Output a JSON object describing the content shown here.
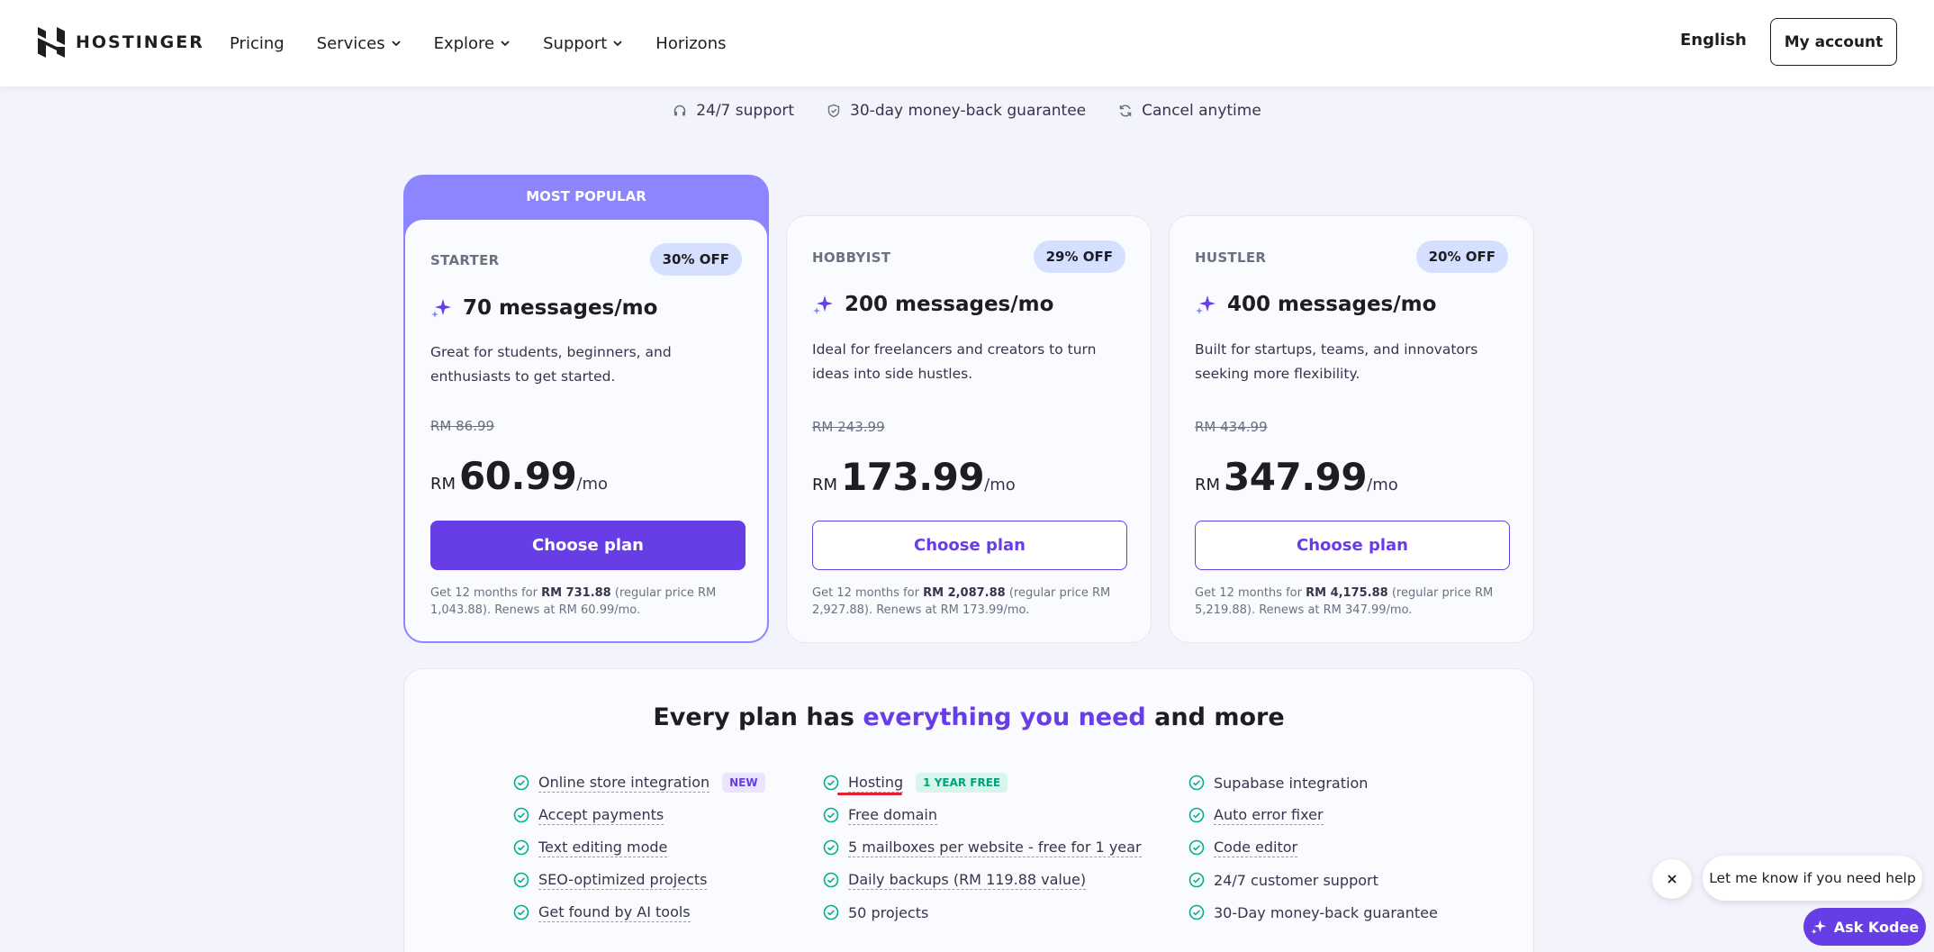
{
  "header": {
    "brand": "HOSTINGER",
    "nav": [
      {
        "label": "Pricing",
        "dropdown": false
      },
      {
        "label": "Services",
        "dropdown": true
      },
      {
        "label": "Explore",
        "dropdown": true
      },
      {
        "label": "Support",
        "dropdown": true
      },
      {
        "label": "Horizons",
        "dropdown": false
      }
    ],
    "language": "English",
    "account_button": "My account"
  },
  "guarantees": [
    {
      "icon": "headset-icon",
      "label": "24/7 support"
    },
    {
      "icon": "shield-check-icon",
      "label": "30-day money-back guarantee"
    },
    {
      "icon": "refresh-icon",
      "label": "Cancel anytime"
    }
  ],
  "popular_label": "MOST POPULAR",
  "plans": [
    {
      "name": "STARTER",
      "discount": "30% OFF",
      "messages": "70 messages/mo",
      "description": "Great for students, beginners, and enthusiasts to get started.",
      "old_price": "RM 86.99",
      "currency": "RM",
      "price": "60.99",
      "per": "/mo",
      "button": "Choose plan",
      "fine_pre": "Get 12 months for ",
      "fine_bold": "RM 731.88",
      "fine_post": " (regular price RM 1,043.88). Renews at RM 60.99/mo."
    },
    {
      "name": "HOBBYIST",
      "discount": "29% OFF",
      "messages": "200 messages/mo",
      "description": "Ideal for freelancers and creators to turn ideas into side hustles.",
      "old_price": "RM 243.99",
      "currency": "RM",
      "price": "173.99",
      "per": "/mo",
      "button": "Choose plan",
      "fine_pre": "Get 12 months for ",
      "fine_bold": "RM 2,087.88",
      "fine_post": " (regular price RM 2,927.88). Renews at RM 173.99/mo."
    },
    {
      "name": "HUSTLER",
      "discount": "20% OFF",
      "messages": "400 messages/mo",
      "description": "Built for startups, teams, and innovators seeking more flexibility.",
      "old_price": "RM 434.99",
      "currency": "RM",
      "price": "347.99",
      "per": "/mo",
      "button": "Choose plan",
      "fine_pre": "Get 12 months for ",
      "fine_bold": "RM 4,175.88",
      "fine_post": " (regular price RM 5,219.88). Renews at RM 347.99/mo."
    }
  ],
  "features": {
    "title_pre": "Every plan has ",
    "title_accent": "everything you need",
    "title_post": " and more",
    "col1": [
      {
        "label": "Online store integration",
        "tag": "NEW"
      },
      {
        "label": "Accept payments"
      },
      {
        "label": "Text editing mode"
      },
      {
        "label": "SEO-optimized projects"
      },
      {
        "label": "Get found by AI tools"
      }
    ],
    "col2": [
      {
        "label": "Hosting",
        "tag": "1 YEAR FREE"
      },
      {
        "label": "Free domain"
      },
      {
        "label": "5 mailboxes per website - free for 1 year"
      },
      {
        "label": "Daily backups (RM 119.88 value)"
      },
      {
        "label": "50 projects"
      }
    ],
    "col3": [
      {
        "label": "Supabase integration"
      },
      {
        "label": "Auto error fixer"
      },
      {
        "label": "Code editor"
      },
      {
        "label": "24/7 customer support"
      },
      {
        "label": "30-Day money-back guarantee"
      }
    ]
  },
  "chat": {
    "bubble": "Let me know if you need help",
    "button": "Ask Kodee"
  },
  "colors": {
    "accent": "#673de6",
    "popular": "#8c85ff",
    "check": "#00b090",
    "background": "#f3f3fc"
  }
}
